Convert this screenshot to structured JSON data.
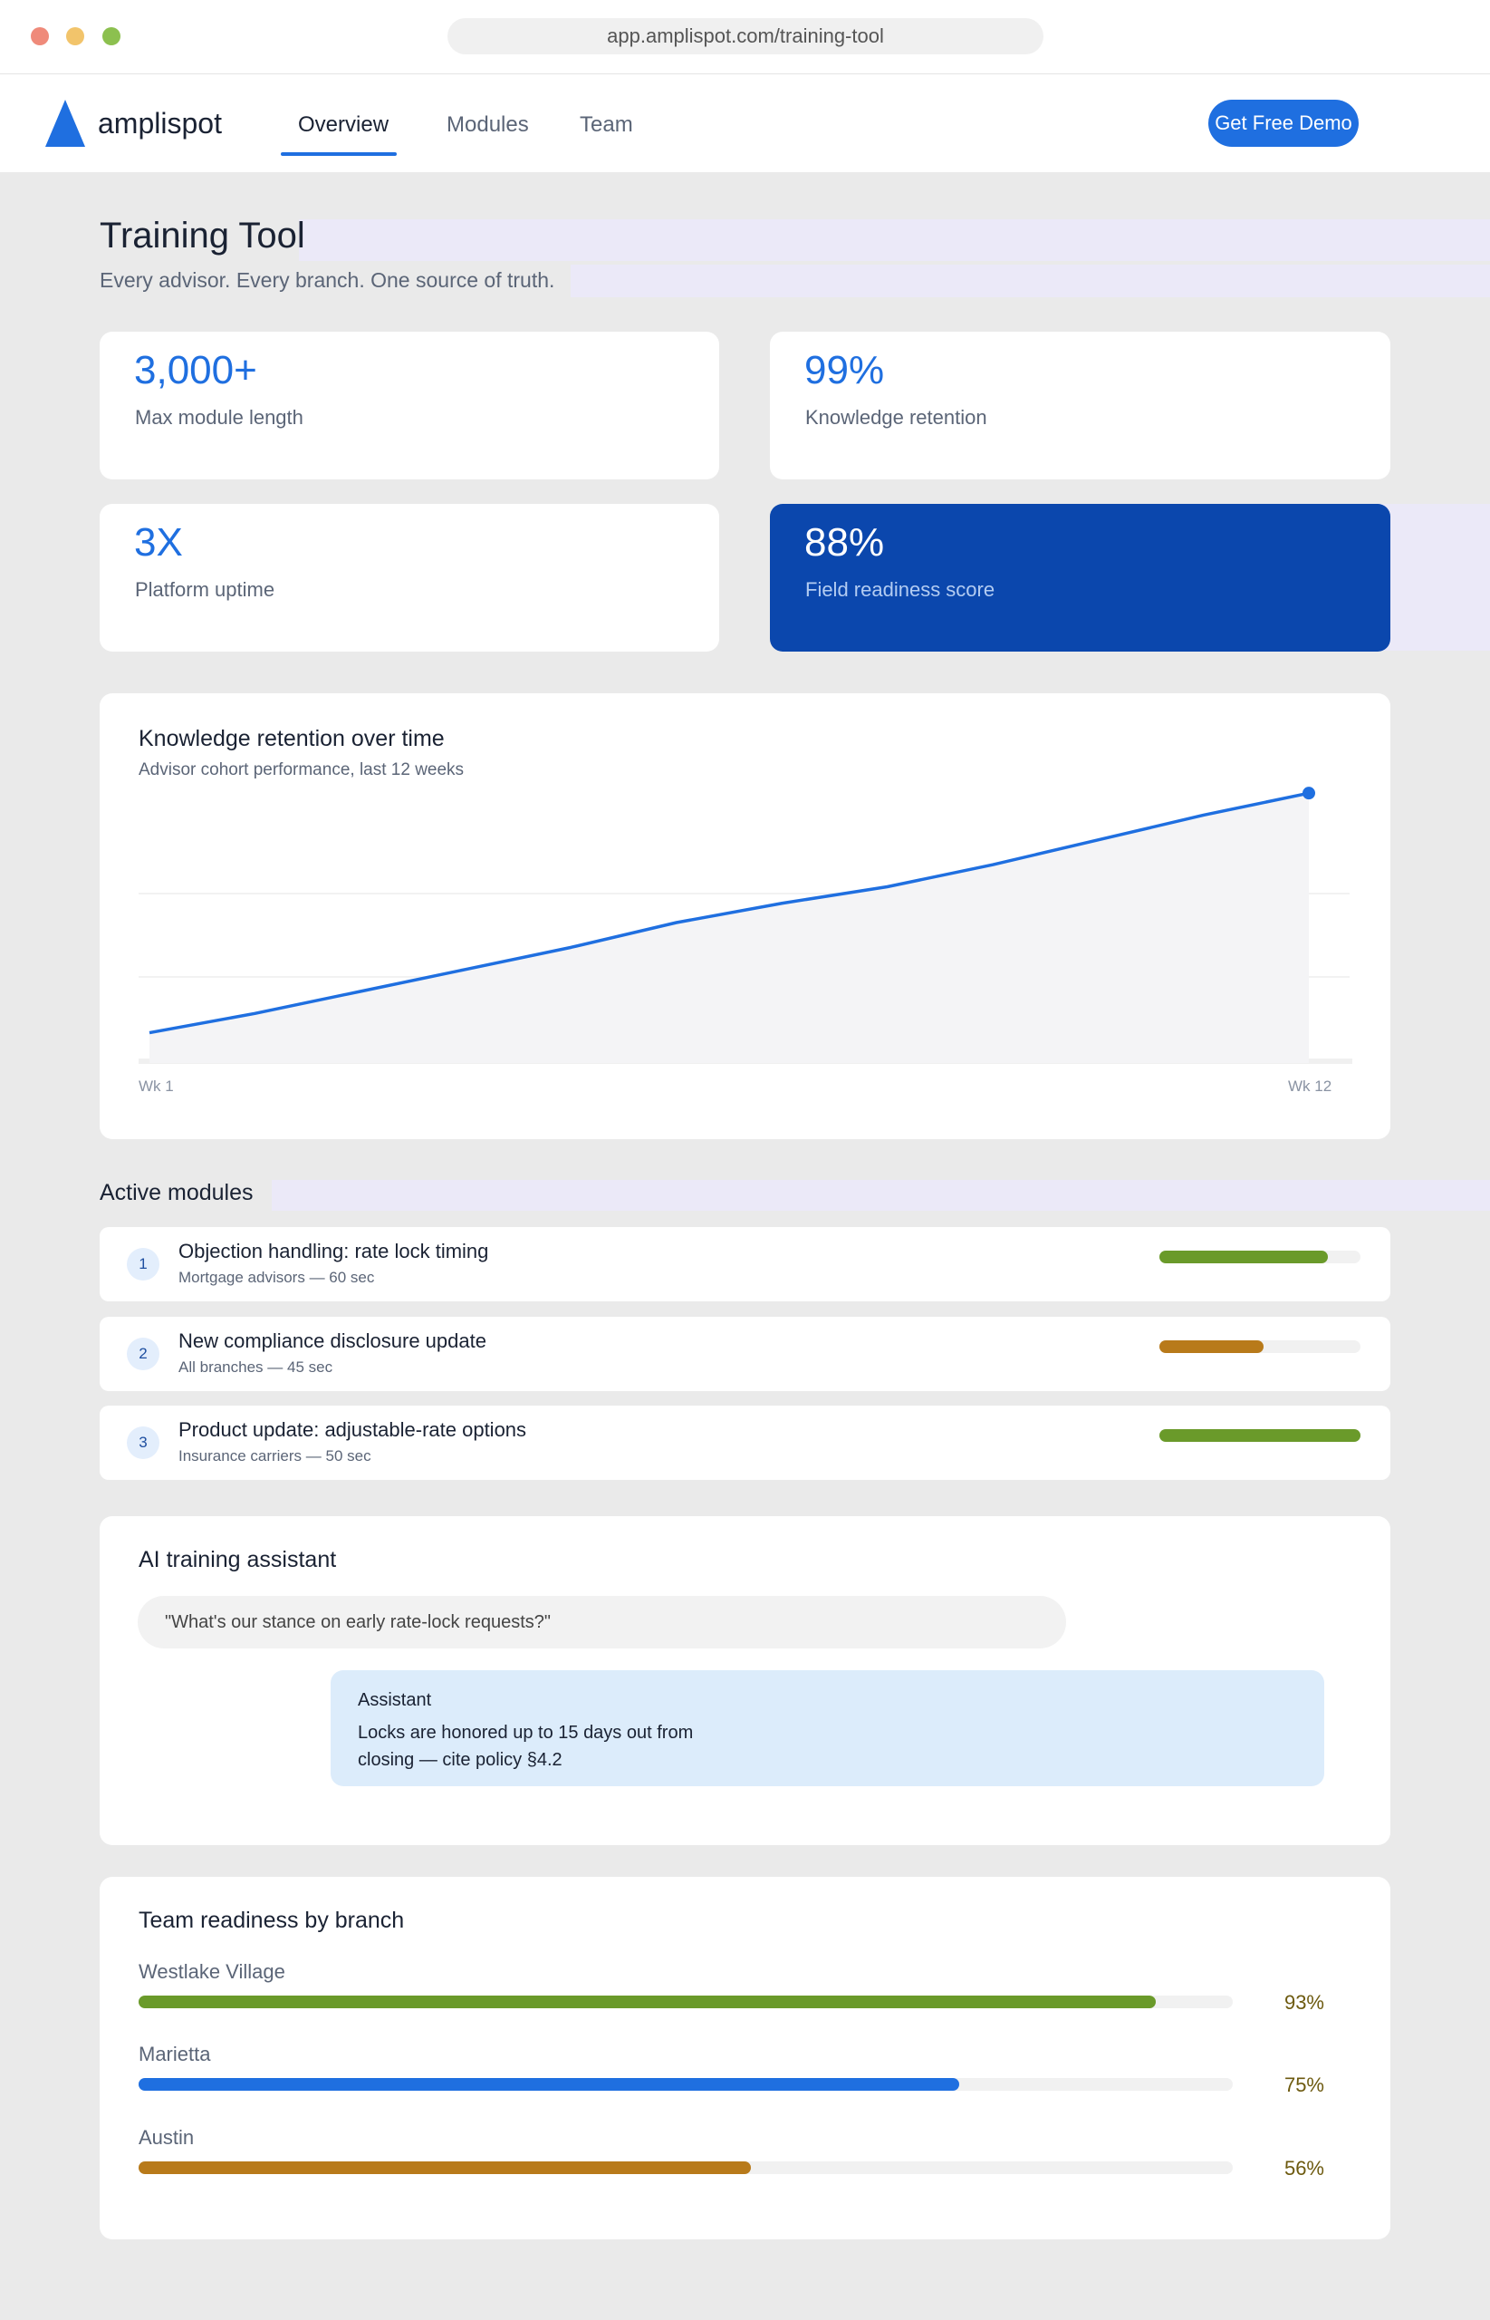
{
  "browser": {
    "url": "app.amplispot.com/training-tool"
  },
  "nav": {
    "brand": "amplispot",
    "tabs": [
      {
        "label": "Overview",
        "active": true
      },
      {
        "label": "Modules",
        "active": false
      },
      {
        "label": "Team",
        "active": false
      }
    ],
    "cta_label": "Get Free Demo",
    "accent_color": "#1f6fe0"
  },
  "header": {
    "title": "Training Tool",
    "subtitle": "Every advisor. Every branch. One source of truth."
  },
  "stats": [
    {
      "value": "3,000+",
      "label": "Max module length"
    },
    {
      "value": "99%",
      "label": "Knowledge retention"
    },
    {
      "value": "3X",
      "label": "Platform uptime"
    },
    {
      "value": "88%",
      "label": "Field readiness score",
      "highlighted": true
    }
  ],
  "retention_chart": {
    "title": "Knowledge retention over time",
    "subtitle": "Advisor cohort performance, last 12 weeks",
    "x_start_label": "Wk 1",
    "x_end_label": "Wk 12"
  },
  "chart_data": {
    "type": "area",
    "title": "Knowledge retention over time",
    "subtitle": "Advisor cohort performance, last 12 weeks",
    "x": [
      "Wk 1",
      "Wk 2",
      "Wk 3",
      "Wk 4",
      "Wk 5",
      "Wk 6",
      "Wk 7",
      "Wk 8",
      "Wk 9",
      "Wk 10",
      "Wk 11",
      "Wk 12"
    ],
    "values": [
      11,
      18,
      26,
      34,
      42,
      51,
      58,
      64,
      72,
      81,
      90,
      98
    ],
    "ylim": [
      0,
      102
    ],
    "xtick_labels": [
      "Wk 1",
      "Wk 12"
    ],
    "grid": true,
    "line_color": "#1f6fe0"
  },
  "modules": {
    "title": "Active modules",
    "items": [
      {
        "num": "1",
        "title": "Objection handling: rate lock timing",
        "meta": "Mortgage advisors — 60 sec",
        "progress": 0.84,
        "color": "#6a9a2a"
      },
      {
        "num": "2",
        "title": "New compliance disclosure update",
        "meta": "All branches — 45 sec",
        "progress": 0.52,
        "color": "#b87a1a"
      },
      {
        "num": "3",
        "title": "Product update: adjustable-rate options",
        "meta": "Insurance carriers — 50 sec",
        "progress": 1.0,
        "color": "#6a9a2a"
      }
    ]
  },
  "assistant": {
    "title": "AI training assistant",
    "query": "\"What's our stance on early rate-lock requests?\"",
    "reply_author": "Assistant",
    "reply_text": "Locks are honored up to 15 days out from closing — cite policy §4.2"
  },
  "readiness": {
    "title": "Team readiness by branch",
    "branches": [
      {
        "name": "Westlake Village",
        "percent_label": "93%",
        "value": 0.93,
        "color": "#6a9a2a"
      },
      {
        "name": "Marietta",
        "percent_label": "75%",
        "value": 0.75,
        "color": "#1f6fe0"
      },
      {
        "name": "Austin",
        "percent_label": "56%",
        "value": 0.56,
        "color": "#b87a1a"
      }
    ]
  }
}
